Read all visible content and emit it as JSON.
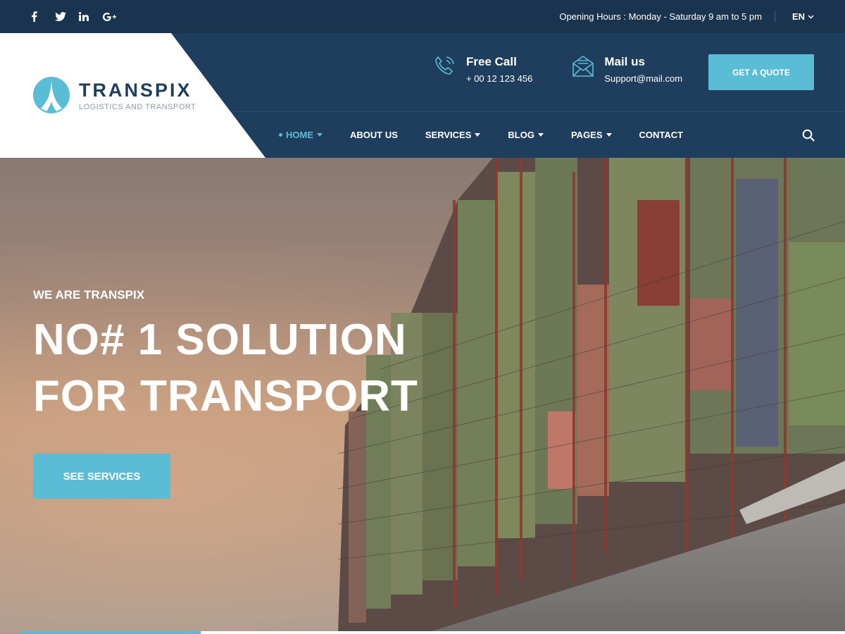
{
  "topbar": {
    "social": [
      "facebook-icon",
      "twitter-icon",
      "linkedin-icon",
      "google-plus-icon"
    ],
    "hours": "Opening Hours : Monday - Saturday 9 am to 5 pm",
    "language": "EN"
  },
  "brand": {
    "name": "TRANSPIX",
    "tagline": "LOGISTICS AND TRANSPORT",
    "color_primary": "#1f3e5e",
    "color_accent": "#5bbcd6"
  },
  "contacts": {
    "call_title": "Free Call",
    "call_value": "+ 00 12 123 456",
    "mail_title": "Mail us",
    "mail_value": "Support@mail.com"
  },
  "quote_button": "GET A QUOTE",
  "nav": {
    "items": [
      {
        "label": "HOME",
        "active": true,
        "dropdown": true
      },
      {
        "label": "ABOUT US",
        "active": false,
        "dropdown": false
      },
      {
        "label": "SERVICES",
        "active": false,
        "dropdown": true
      },
      {
        "label": "BLOG",
        "active": false,
        "dropdown": true
      },
      {
        "label": "PAGES",
        "active": false,
        "dropdown": true
      },
      {
        "label": "CONTACT",
        "active": false,
        "dropdown": false
      }
    ]
  },
  "hero": {
    "eyebrow": "WE ARE TRANSPIX",
    "headline_line1": "NO# 1 SOLUTION",
    "headline_line2": "FOR TRANSPORT",
    "cta": "SEE SERVICES"
  }
}
